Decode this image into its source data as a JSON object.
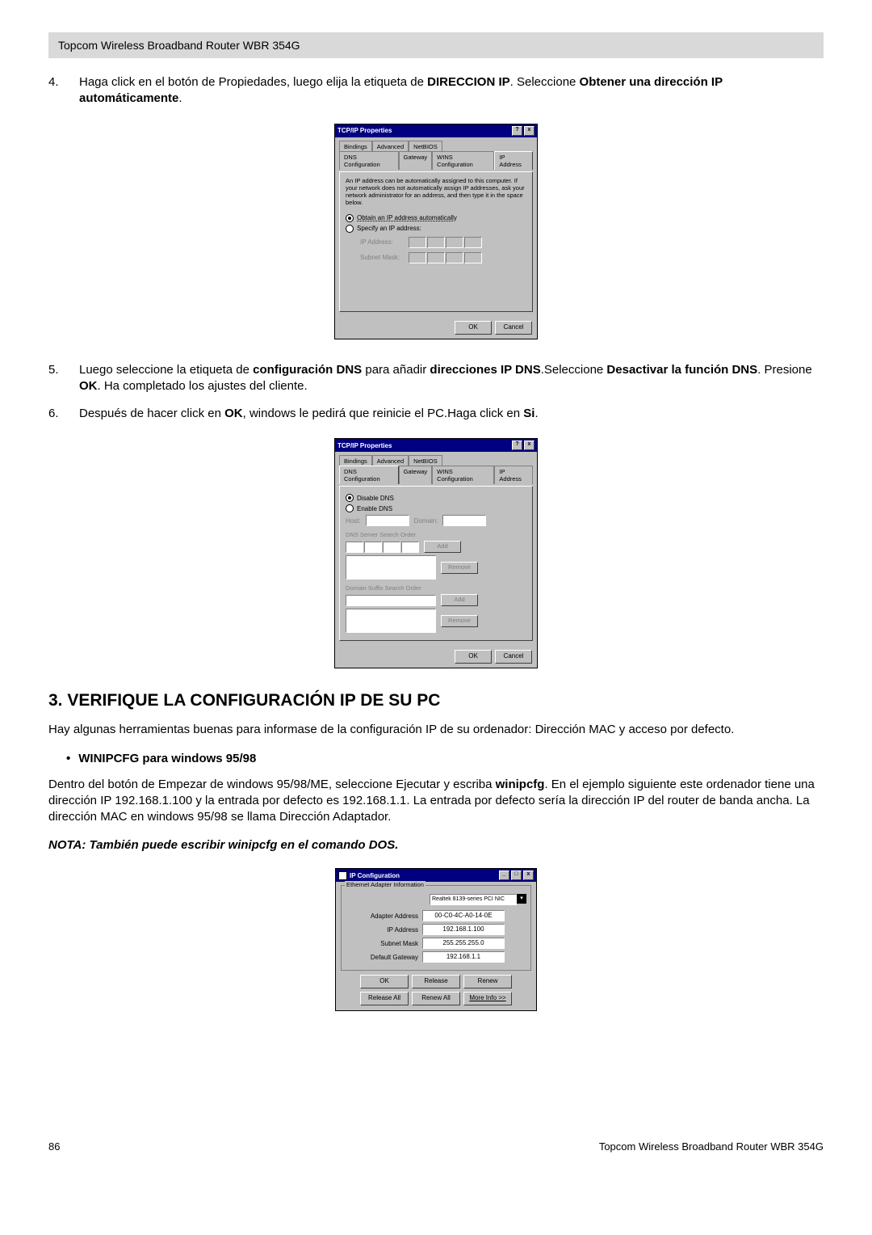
{
  "header": {
    "title": "Topcom Wireless Broadband Router WBR 354G"
  },
  "steps": {
    "s4": {
      "num": "4.",
      "t1": "Haga click en el botón de Propiedades, luego elija la etiqueta de ",
      "b1": "DIRECCION IP",
      "t2": ". Seleccione ",
      "b2": "Obtener una dirección IP automáticamente",
      "t3": "."
    },
    "s5": {
      "num": "5.",
      "t1": "Luego seleccione la etiqueta de ",
      "b1": "configuración DNS",
      "t2": " para añadir ",
      "b2": "direcciones IP DNS",
      "t3": ".Seleccione ",
      "b3": "Desactivar la función DNS",
      "t4": ". Presione ",
      "b4": "OK",
      "t5": ". Ha completado los ajustes del cliente."
    },
    "s6": {
      "num": "6.",
      "t1": "Después de hacer click en ",
      "b1": "OK",
      "t2": ", windows le pedirá que reinicie el PC.Haga click en ",
      "b2": "Si",
      "t3": "."
    }
  },
  "dialog1": {
    "title": "TCP/IP Properties",
    "help_btn": "?",
    "close_btn": "x",
    "tabs_row1": {
      "bindings": "Bindings",
      "advanced": "Advanced",
      "netbios": "NetBIOS"
    },
    "tabs_row2": {
      "dnsconf": "DNS Configuration",
      "gateway": "Gateway",
      "winsconf": "WINS Configuration",
      "ipaddr": "IP Address"
    },
    "info": "An IP address can be automatically assigned to this computer. If your network does not automatically assign IP addresses, ask your network administrator for an address, and then type it in the space below.",
    "radio_auto": "Obtain an IP address automatically",
    "radio_specify": "Specify an IP address:",
    "lbl_ip": "IP Address:",
    "lbl_mask": "Subnet Mask:",
    "ok": "OK",
    "cancel": "Cancel"
  },
  "dialog2": {
    "title": "TCP/IP Properties",
    "help_btn": "?",
    "close_btn": "x",
    "tabs_row1": {
      "bindings": "Bindings",
      "advanced": "Advanced",
      "netbios": "NetBIOS"
    },
    "tabs_row2": {
      "dnsconf": "DNS Configuration",
      "gateway": "Gateway",
      "winsconf": "WINS Configuration",
      "ipaddr": "IP Address"
    },
    "radio_disable": "Disable DNS",
    "radio_enable": "Enable DNS",
    "lbl_host": "Host:",
    "lbl_domain": "Domain:",
    "lbl_dns_order": "DNS Server Search Order",
    "btn_add": "Add",
    "btn_remove": "Remove",
    "lbl_suffix": "Domain Suffix Search Order",
    "ok": "OK",
    "cancel": "Cancel"
  },
  "section3": {
    "heading": "3.  VERIFIQUE LA CONFIGURACIÓN IP DE SU PC",
    "para1": "Hay algunas herramientas buenas para informase de la configuración IP de su ordenador: Dirección MAC y acceso por defecto.",
    "bullet1": "WINIPCFG para windows 95/98",
    "para2_t1": "Dentro del botón de Empezar de windows 95/98/ME, seleccione Ejecutar y escriba ",
    "para2_b1": "winipcfg",
    "para2_t2": ". En el ejemplo siguiente este ordenador tiene una dirección IP 192.168.1.100 y la entrada por defecto es 192.168.1.1. La entrada por defecto sería la dirección IP del router de banda ancha. La dirección MAC en windows 95/98 se llama Dirección Adaptador.",
    "note": "NOTA: También puede escribir winipcfg en el comando DOS."
  },
  "dialog3": {
    "title": "IP Configuration",
    "min_btn": "_",
    "max_btn": "□",
    "close_btn": "x",
    "group_title": "Ethernet Adapter Information",
    "adapter": "Realtek 8139-series PCI NIC",
    "lbl_addr": "Adapter Address",
    "val_addr": "00-C0-4C-A0-14-0E",
    "lbl_ip": "IP Address",
    "val_ip": "192.168.1.100",
    "lbl_mask": "Subnet Mask",
    "val_mask": "255.255.255.0",
    "lbl_gw": "Default Gateway",
    "val_gw": "192.168.1.1",
    "btn_ok": "OK",
    "btn_release": "Release",
    "btn_renew": "Renew",
    "btn_release_all": "Release All",
    "btn_renew_all": "Renew All",
    "btn_more": "More Info >>"
  },
  "footer": {
    "page": "86",
    "right": "Topcom Wireless Broadband Router WBR 354G"
  }
}
